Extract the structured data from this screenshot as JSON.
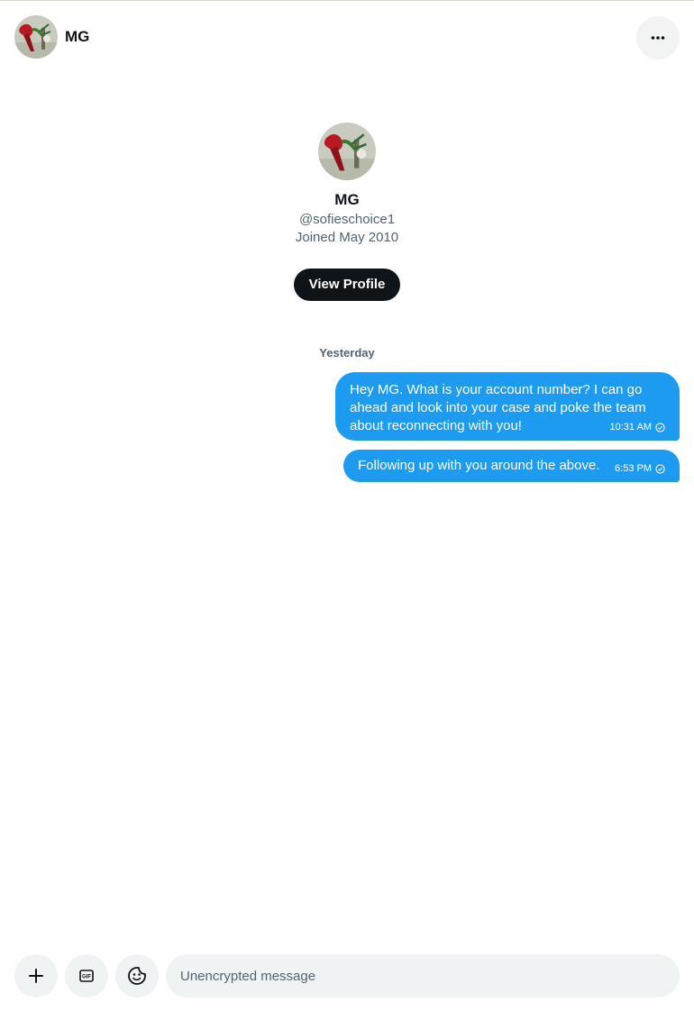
{
  "header": {
    "name": "MG",
    "more_icon": "more-horizontal-icon"
  },
  "profile": {
    "name": "MG",
    "handle": "@sofieschoice1",
    "joined": "Joined May 2010",
    "view_profile_label": "View Profile"
  },
  "conversation": {
    "day_label": "Yesterday",
    "messages": [
      {
        "text": "Hey MG. What is your account number? I can go ahead and look into your case and poke the team about reconnecting with you!",
        "time": "10:31 AM",
        "status_icon": "sent-check-icon"
      },
      {
        "text": "Following up with you around the above.",
        "time": "6:53 PM",
        "status_icon": "sent-check-icon"
      }
    ]
  },
  "composer": {
    "placeholder": "Unencrypted message",
    "value": "",
    "add_icon": "plus-icon",
    "gif_icon": "gif-icon",
    "emoji_icon": "emoji-icon"
  },
  "colors": {
    "accent": "#1d9bf0",
    "primary_button": "#0f1419",
    "secondary_text": "#536471",
    "input_bg": "#eff3f4"
  }
}
